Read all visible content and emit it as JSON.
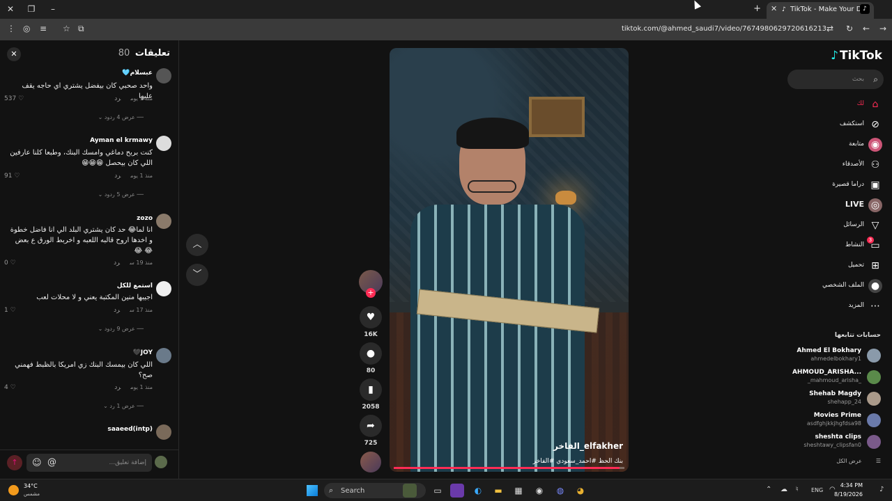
{
  "browser": {
    "tab_title": "TikTok - Make Your Day",
    "url": "tiktok.com/@ahmed_saudi7/video/7674980629720616213"
  },
  "comments_panel": {
    "title": "تعليقات",
    "count": "80",
    "input_placeholder": "إضافة تعليق...",
    "items": [
      {
        "user": "عبسلام🩵",
        "text": "واحد صحبي كان بيفضل يشتري اي حاجه يقف عليها",
        "time": "منذ 1 يوم",
        "reply": "رد",
        "likes": "537",
        "more": "عرض 4 ردود"
      },
      {
        "user": "Ayman el krmawy",
        "text": "كنت بربح دماغي وامسك البنك، وطبعا كلنا عارفين اللي كان بيحصل 😁😁😁",
        "time": "منذ 1 يوم",
        "reply": "رد",
        "likes": "91",
        "more": "عرض 5 ردود"
      },
      {
        "user": "zozo",
        "text": "انا لما😂 حد كان يشتري البلد الي انا فاضل خطوة و اخدها اروح قالبه اللعبه و اخربط الورق ع بعض 😂 😂",
        "time": "منذ 19 س",
        "reply": "رد",
        "likes": "0",
        "more": ""
      },
      {
        "user": "استمع للكل",
        "text": "اجيبها منين المكتبة يعني و لا محلات لعب",
        "time": "منذ 17 س",
        "reply": "رد",
        "likes": "1",
        "more": "عرض 9 ردود"
      },
      {
        "user": "JOY🖤",
        "text": "اللي كان بيمسك البنك زي امريكا بالظبط فهمني صح؟",
        "time": "منذ 1 يوم",
        "reply": "رد",
        "likes": "4",
        "more": "عرض 1 رد"
      },
      {
        "user": "saaeed(intp)",
        "text": "",
        "time": "",
        "reply": "",
        "likes": "",
        "more": ""
      }
    ]
  },
  "video": {
    "username": "elfakher_الفاخر",
    "caption": "بنك الحظ #احمد_سعودي #الفاخر",
    "progress": 0.98
  },
  "actions": {
    "likes": "16K",
    "comments": "80",
    "saves": "2058",
    "shares": "725"
  },
  "sidebar": {
    "logo": "TikTok",
    "search_placeholder": "بحث",
    "nav": [
      {
        "label": "لك",
        "icon": "home-icon"
      },
      {
        "label": "استكشف",
        "icon": "compass-icon"
      },
      {
        "label": "متابعة",
        "icon": "following-icon"
      },
      {
        "label": "الأصدقاء",
        "icon": "friends-icon"
      },
      {
        "label": "دراما قصيرة",
        "icon": "drama-icon"
      },
      {
        "label": "LIVE",
        "icon": "live-icon"
      },
      {
        "label": "الرسائل",
        "icon": "messages-icon"
      },
      {
        "label": "النشاط",
        "icon": "activity-icon"
      },
      {
        "label": "تحميل",
        "icon": "upload-icon"
      },
      {
        "label": "الملف الشخصي",
        "icon": "profile-icon"
      },
      {
        "label": "المزيد",
        "icon": "more-icon"
      }
    ],
    "activity_badge": "3",
    "following_title": "حسابات تتابعها",
    "accounts": [
      {
        "name": "Ahmed El Bokhary",
        "handle": "ahmedelbokhary1"
      },
      {
        "name": "AHMOUD_ARISHA...",
        "handle": "_mahmoud_arisha_"
      },
      {
        "name": "Shehab Magdy",
        "handle": "shehapp_24"
      },
      {
        "name": "Movies Prime",
        "handle": "asdfghjkkjhgfdsa98"
      },
      {
        "name": "sheshta clips",
        "handle": "sheshtawy_clipsfan0"
      }
    ],
    "see_all": "عرض الكل"
  },
  "taskbar": {
    "weather_temp": "34°C",
    "weather_desc": "مشمس",
    "search_placeholder": "Search",
    "lang": "ENG",
    "time": "4:34 PM",
    "date": "8/19/2026"
  }
}
